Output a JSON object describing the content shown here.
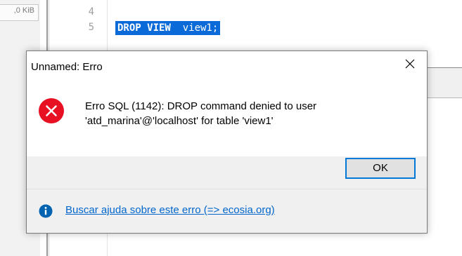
{
  "editor": {
    "size_chip": ",0 KiB",
    "line_numbers": [
      "4",
      "5"
    ],
    "code_keyword": "DROP VIEW",
    "code_rest": "  view1;"
  },
  "dialog": {
    "title": "Unnamed: Erro",
    "close_icon": "close-icon",
    "error_icon": "error-icon",
    "message_line1": "Erro SQL (1142): DROP command denied to user",
    "message_line2": "'atd_marina'@'localhost' for table 'view1'",
    "ok_label": "OK",
    "info_icon": "info-icon",
    "help_link": "Buscar ajuda sobre este erro (=> ecosia.org)"
  },
  "colors": {
    "selection": "#0a6bd8",
    "error_red": "#e81123",
    "info_blue": "#0063b1",
    "link": "#0066cc",
    "button_focus": "#0078d7"
  }
}
